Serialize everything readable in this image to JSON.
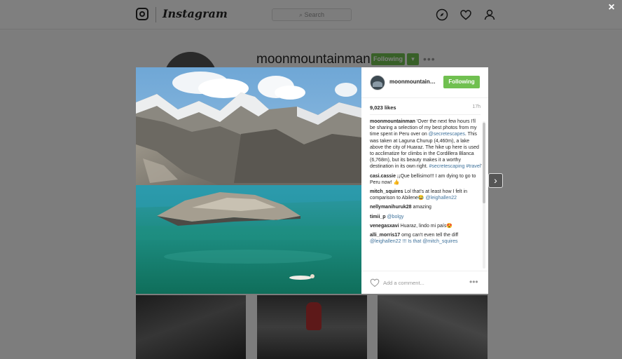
{
  "nav": {
    "wordmark": "Instagram",
    "search_placeholder": "Search",
    "icons": [
      "compass-icon",
      "heart-icon",
      "user-icon"
    ]
  },
  "profile": {
    "username": "moonmountainman",
    "following_label": "Following",
    "caret": "▾",
    "more": "•••"
  },
  "modal": {
    "close": "×",
    "next": "›",
    "post": {
      "username": "moonmountainman",
      "username_display": "moonmountainman",
      "follow_label": "Following",
      "likes": "9,023 likes",
      "time": "17h",
      "caption": {
        "user": "moonmountainman",
        "text_1": " 'Over the next few hours I'll be sharing a selection of my best photos from my time spent in Peru over on ",
        "link_1": "@secretescapes",
        "text_2": ". This was taken at Laguna Churup (4,460m), a lake above the city of Huaraz. The hike up here is used to acclimatize for climbs in the Cordillera Blanca (6,768m), but its beauty makes it a worthy destination in its own right. ",
        "link_2": "#secretescaping #travel",
        "text_3": "'"
      },
      "comments": [
        {
          "user": "casi.cassie",
          "text": " ¡¡Que bellisimo!!! I am dying to go to Peru now! 👍",
          "link": ""
        },
        {
          "user": "mitch_squires",
          "text": " Lol that's at least how I felt in comparison to Abilene😂 ",
          "link": "@leighallen22"
        },
        {
          "user": "nellymanihuruk28",
          "text": " amazing",
          "link": ""
        },
        {
          "user": "timii_p",
          "text": " ",
          "link": "@bolgy"
        },
        {
          "user": "venegasxavi",
          "text": " Huaraz, lindo mi país😍",
          "link": ""
        },
        {
          "user": "alli_morris17",
          "text": " omg can't even tell the diff ",
          "link": "@leighallen22 !!! Is that @mitch_squires"
        }
      ],
      "add_comment_placeholder": "Add a comment...",
      "more": "•••"
    }
  }
}
